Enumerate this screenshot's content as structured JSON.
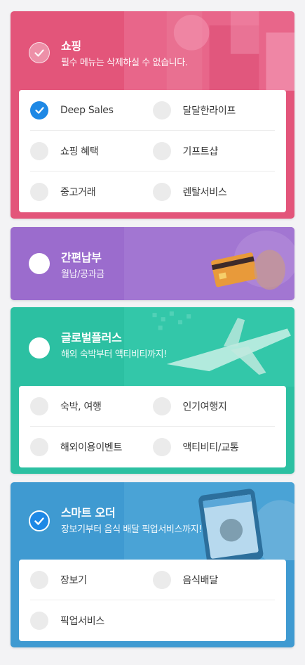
{
  "colors": {
    "shopping": "#e3557a",
    "easypay": "#9b6ccd",
    "global": "#2cc0a2",
    "smartorder": "#3f9ad1",
    "checked": "#1e88e5"
  },
  "cards": [
    {
      "key": "shopping",
      "title": "쇼핑",
      "subtitle": "필수 메뉴는 삭제하실 수 없습니다.",
      "head_icon": "check-icon-disabled",
      "items": [
        {
          "label": "Deep Sales",
          "checked": true
        },
        {
          "label": "달달한라이프",
          "checked": false
        },
        {
          "label": "쇼핑 혜택",
          "checked": false
        },
        {
          "label": "기프트샵",
          "checked": false
        },
        {
          "label": "중고거래",
          "checked": false
        },
        {
          "label": "렌탈서비스",
          "checked": false
        }
      ]
    },
    {
      "key": "easypay",
      "title": "간편납부",
      "subtitle": "월납/공과금",
      "head_icon": "unchecked-circle",
      "items": []
    },
    {
      "key": "global",
      "title": "글로벌플러스",
      "subtitle": "해외 숙박부터 액티비티까지!",
      "head_icon": "unchecked-circle",
      "items": [
        {
          "label": "숙박, 여행",
          "checked": false
        },
        {
          "label": "인기여행지",
          "checked": false
        },
        {
          "label": "해외이용이벤트",
          "checked": false
        },
        {
          "label": "액티비티/교통",
          "checked": false
        }
      ]
    },
    {
      "key": "smartorder",
      "title": "스마트 오더",
      "subtitle": "장보기부터 음식 배달 픽업서비스까지!",
      "head_icon": "check-icon",
      "items": [
        {
          "label": "장보기",
          "checked": false
        },
        {
          "label": "음식배달",
          "checked": false
        },
        {
          "label": "픽업서비스",
          "checked": false
        }
      ]
    }
  ]
}
